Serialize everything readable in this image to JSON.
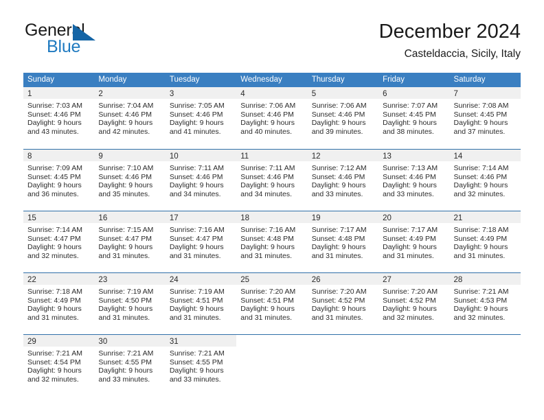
{
  "brand": {
    "word1": "General",
    "word2": "Blue",
    "logo_icon": "triangle-logo-icon"
  },
  "header": {
    "title": "December 2024",
    "subtitle": "Casteldaccia, Sicily, Italy"
  },
  "colors": {
    "header_blue": "#3a7fc1",
    "week_divider_blue": "#2f6fa8",
    "day_band_gray": "#f0f0f0",
    "brand_blue": "#1f7ac0",
    "logo_blue": "#1565a6",
    "text": "#2a2a2a"
  },
  "weekdays": [
    "Sunday",
    "Monday",
    "Tuesday",
    "Wednesday",
    "Thursday",
    "Friday",
    "Saturday"
  ],
  "weeks": [
    [
      {
        "day": "1",
        "sunrise": "Sunrise: 7:03 AM",
        "sunset": "Sunset: 4:46 PM",
        "daylight1": "Daylight: 9 hours",
        "daylight2": "and 43 minutes."
      },
      {
        "day": "2",
        "sunrise": "Sunrise: 7:04 AM",
        "sunset": "Sunset: 4:46 PM",
        "daylight1": "Daylight: 9 hours",
        "daylight2": "and 42 minutes."
      },
      {
        "day": "3",
        "sunrise": "Sunrise: 7:05 AM",
        "sunset": "Sunset: 4:46 PM",
        "daylight1": "Daylight: 9 hours",
        "daylight2": "and 41 minutes."
      },
      {
        "day": "4",
        "sunrise": "Sunrise: 7:06 AM",
        "sunset": "Sunset: 4:46 PM",
        "daylight1": "Daylight: 9 hours",
        "daylight2": "and 40 minutes."
      },
      {
        "day": "5",
        "sunrise": "Sunrise: 7:06 AM",
        "sunset": "Sunset: 4:46 PM",
        "daylight1": "Daylight: 9 hours",
        "daylight2": "and 39 minutes."
      },
      {
        "day": "6",
        "sunrise": "Sunrise: 7:07 AM",
        "sunset": "Sunset: 4:45 PM",
        "daylight1": "Daylight: 9 hours",
        "daylight2": "and 38 minutes."
      },
      {
        "day": "7",
        "sunrise": "Sunrise: 7:08 AM",
        "sunset": "Sunset: 4:45 PM",
        "daylight1": "Daylight: 9 hours",
        "daylight2": "and 37 minutes."
      }
    ],
    [
      {
        "day": "8",
        "sunrise": "Sunrise: 7:09 AM",
        "sunset": "Sunset: 4:45 PM",
        "daylight1": "Daylight: 9 hours",
        "daylight2": "and 36 minutes."
      },
      {
        "day": "9",
        "sunrise": "Sunrise: 7:10 AM",
        "sunset": "Sunset: 4:46 PM",
        "daylight1": "Daylight: 9 hours",
        "daylight2": "and 35 minutes."
      },
      {
        "day": "10",
        "sunrise": "Sunrise: 7:11 AM",
        "sunset": "Sunset: 4:46 PM",
        "daylight1": "Daylight: 9 hours",
        "daylight2": "and 34 minutes."
      },
      {
        "day": "11",
        "sunrise": "Sunrise: 7:11 AM",
        "sunset": "Sunset: 4:46 PM",
        "daylight1": "Daylight: 9 hours",
        "daylight2": "and 34 minutes."
      },
      {
        "day": "12",
        "sunrise": "Sunrise: 7:12 AM",
        "sunset": "Sunset: 4:46 PM",
        "daylight1": "Daylight: 9 hours",
        "daylight2": "and 33 minutes."
      },
      {
        "day": "13",
        "sunrise": "Sunrise: 7:13 AM",
        "sunset": "Sunset: 4:46 PM",
        "daylight1": "Daylight: 9 hours",
        "daylight2": "and 33 minutes."
      },
      {
        "day": "14",
        "sunrise": "Sunrise: 7:14 AM",
        "sunset": "Sunset: 4:46 PM",
        "daylight1": "Daylight: 9 hours",
        "daylight2": "and 32 minutes."
      }
    ],
    [
      {
        "day": "15",
        "sunrise": "Sunrise: 7:14 AM",
        "sunset": "Sunset: 4:47 PM",
        "daylight1": "Daylight: 9 hours",
        "daylight2": "and 32 minutes."
      },
      {
        "day": "16",
        "sunrise": "Sunrise: 7:15 AM",
        "sunset": "Sunset: 4:47 PM",
        "daylight1": "Daylight: 9 hours",
        "daylight2": "and 31 minutes."
      },
      {
        "day": "17",
        "sunrise": "Sunrise: 7:16 AM",
        "sunset": "Sunset: 4:47 PM",
        "daylight1": "Daylight: 9 hours",
        "daylight2": "and 31 minutes."
      },
      {
        "day": "18",
        "sunrise": "Sunrise: 7:16 AM",
        "sunset": "Sunset: 4:48 PM",
        "daylight1": "Daylight: 9 hours",
        "daylight2": "and 31 minutes."
      },
      {
        "day": "19",
        "sunrise": "Sunrise: 7:17 AM",
        "sunset": "Sunset: 4:48 PM",
        "daylight1": "Daylight: 9 hours",
        "daylight2": "and 31 minutes."
      },
      {
        "day": "20",
        "sunrise": "Sunrise: 7:17 AM",
        "sunset": "Sunset: 4:49 PM",
        "daylight1": "Daylight: 9 hours",
        "daylight2": "and 31 minutes."
      },
      {
        "day": "21",
        "sunrise": "Sunrise: 7:18 AM",
        "sunset": "Sunset: 4:49 PM",
        "daylight1": "Daylight: 9 hours",
        "daylight2": "and 31 minutes."
      }
    ],
    [
      {
        "day": "22",
        "sunrise": "Sunrise: 7:18 AM",
        "sunset": "Sunset: 4:49 PM",
        "daylight1": "Daylight: 9 hours",
        "daylight2": "and 31 minutes."
      },
      {
        "day": "23",
        "sunrise": "Sunrise: 7:19 AM",
        "sunset": "Sunset: 4:50 PM",
        "daylight1": "Daylight: 9 hours",
        "daylight2": "and 31 minutes."
      },
      {
        "day": "24",
        "sunrise": "Sunrise: 7:19 AM",
        "sunset": "Sunset: 4:51 PM",
        "daylight1": "Daylight: 9 hours",
        "daylight2": "and 31 minutes."
      },
      {
        "day": "25",
        "sunrise": "Sunrise: 7:20 AM",
        "sunset": "Sunset: 4:51 PM",
        "daylight1": "Daylight: 9 hours",
        "daylight2": "and 31 minutes."
      },
      {
        "day": "26",
        "sunrise": "Sunrise: 7:20 AM",
        "sunset": "Sunset: 4:52 PM",
        "daylight1": "Daylight: 9 hours",
        "daylight2": "and 31 minutes."
      },
      {
        "day": "27",
        "sunrise": "Sunrise: 7:20 AM",
        "sunset": "Sunset: 4:52 PM",
        "daylight1": "Daylight: 9 hours",
        "daylight2": "and 32 minutes."
      },
      {
        "day": "28",
        "sunrise": "Sunrise: 7:21 AM",
        "sunset": "Sunset: 4:53 PM",
        "daylight1": "Daylight: 9 hours",
        "daylight2": "and 32 minutes."
      }
    ],
    [
      {
        "day": "29",
        "sunrise": "Sunrise: 7:21 AM",
        "sunset": "Sunset: 4:54 PM",
        "daylight1": "Daylight: 9 hours",
        "daylight2": "and 32 minutes."
      },
      {
        "day": "30",
        "sunrise": "Sunrise: 7:21 AM",
        "sunset": "Sunset: 4:55 PM",
        "daylight1": "Daylight: 9 hours",
        "daylight2": "and 33 minutes."
      },
      {
        "day": "31",
        "sunrise": "Sunrise: 7:21 AM",
        "sunset": "Sunset: 4:55 PM",
        "daylight1": "Daylight: 9 hours",
        "daylight2": "and 33 minutes."
      },
      {
        "day": "",
        "sunrise": "",
        "sunset": "",
        "daylight1": "",
        "daylight2": ""
      },
      {
        "day": "",
        "sunrise": "",
        "sunset": "",
        "daylight1": "",
        "daylight2": ""
      },
      {
        "day": "",
        "sunrise": "",
        "sunset": "",
        "daylight1": "",
        "daylight2": ""
      },
      {
        "day": "",
        "sunrise": "",
        "sunset": "",
        "daylight1": "",
        "daylight2": ""
      }
    ]
  ]
}
